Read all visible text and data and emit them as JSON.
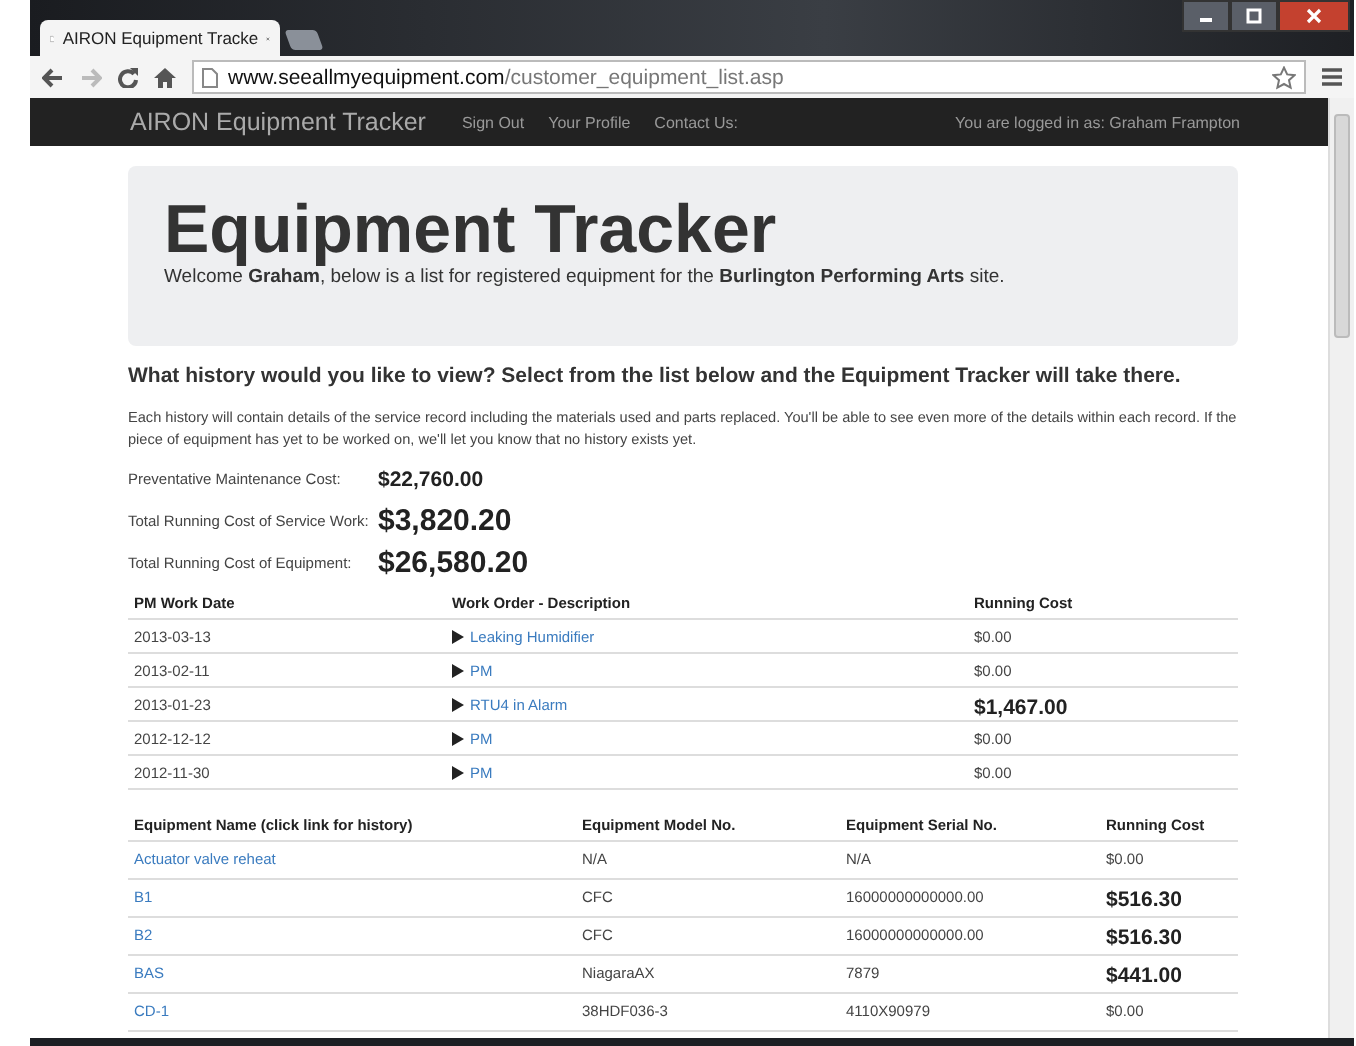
{
  "browser": {
    "tab_title": "AIRON Equipment Tracke",
    "url_domain": "www.seeallmyequipment.com",
    "url_path": "/customer_equipment_list.asp"
  },
  "navbar": {
    "brand": "AIRON Equipment Tracker",
    "links": [
      "Sign Out",
      "Your Profile",
      "Contact Us:"
    ],
    "logged_in": "You are logged in as: Graham Frampton"
  },
  "hero": {
    "title": "Equipment Tracker",
    "welcome": "Welcome **Graham**, below is a list for registered equipment for the **Burlington Performing Arts** site."
  },
  "question": "What history would you like to view? Select from the list below and the Equipment Tracker will take there.",
  "intro": "Each history will contain details of the service record including the materials used and parts replaced. You'll be able to see even more of the details within each record. If the piece of equipment has yet to be worked on, we'll let you know that no history exists yet.",
  "costs": [
    {
      "label": "Preventative Maintenance Cost:",
      "value": "$22,760.00",
      "emphasized": false
    },
    {
      "label": "Total Running Cost of Service Work:",
      "value": "$3,820.20",
      "emphasized": true
    },
    {
      "label": "Total Running Cost of Equipment:",
      "value": "$26,580.20",
      "emphasized": true
    }
  ],
  "work_orders": {
    "columns": [
      "PM Work Date",
      "Work Order - Description",
      "Running Cost"
    ],
    "rows": [
      {
        "date": "2013-03-13",
        "description": "Leaking Humidifier",
        "cost": "$0.00",
        "emphasized": false
      },
      {
        "date": "2013-02-11",
        "description": "PM",
        "cost": "$0.00",
        "emphasized": false
      },
      {
        "date": "2013-01-23",
        "description": "RTU4 in Alarm",
        "cost": "$1,467.00",
        "emphasized": true
      },
      {
        "date": "2012-12-12",
        "description": "PM",
        "cost": "$0.00",
        "emphasized": false
      },
      {
        "date": "2012-11-30",
        "description": "PM",
        "cost": "$0.00",
        "emphasized": false
      }
    ]
  },
  "equipment": {
    "columns": [
      "Equipment Name (click link for history)",
      "Equipment Model No.",
      "Equipment Serial No.",
      "Running Cost"
    ],
    "rows": [
      {
        "name": "Actuator valve reheat",
        "model": "N/A",
        "serial": "N/A",
        "cost": "$0.00",
        "emphasized": false
      },
      {
        "name": "B1",
        "model": "CFC",
        "serial": "16000000000000.00",
        "cost": "$516.30",
        "emphasized": true
      },
      {
        "name": "B2",
        "model": "CFC",
        "serial": "16000000000000.00",
        "cost": "$516.30",
        "emphasized": true
      },
      {
        "name": "BAS",
        "model": "NiagaraAX",
        "serial": "7879",
        "cost": "$441.00",
        "emphasized": true
      },
      {
        "name": "CD-1",
        "model": "38HDF036-3",
        "serial": "4110X90979",
        "cost": "$0.00",
        "emphasized": false
      }
    ]
  }
}
